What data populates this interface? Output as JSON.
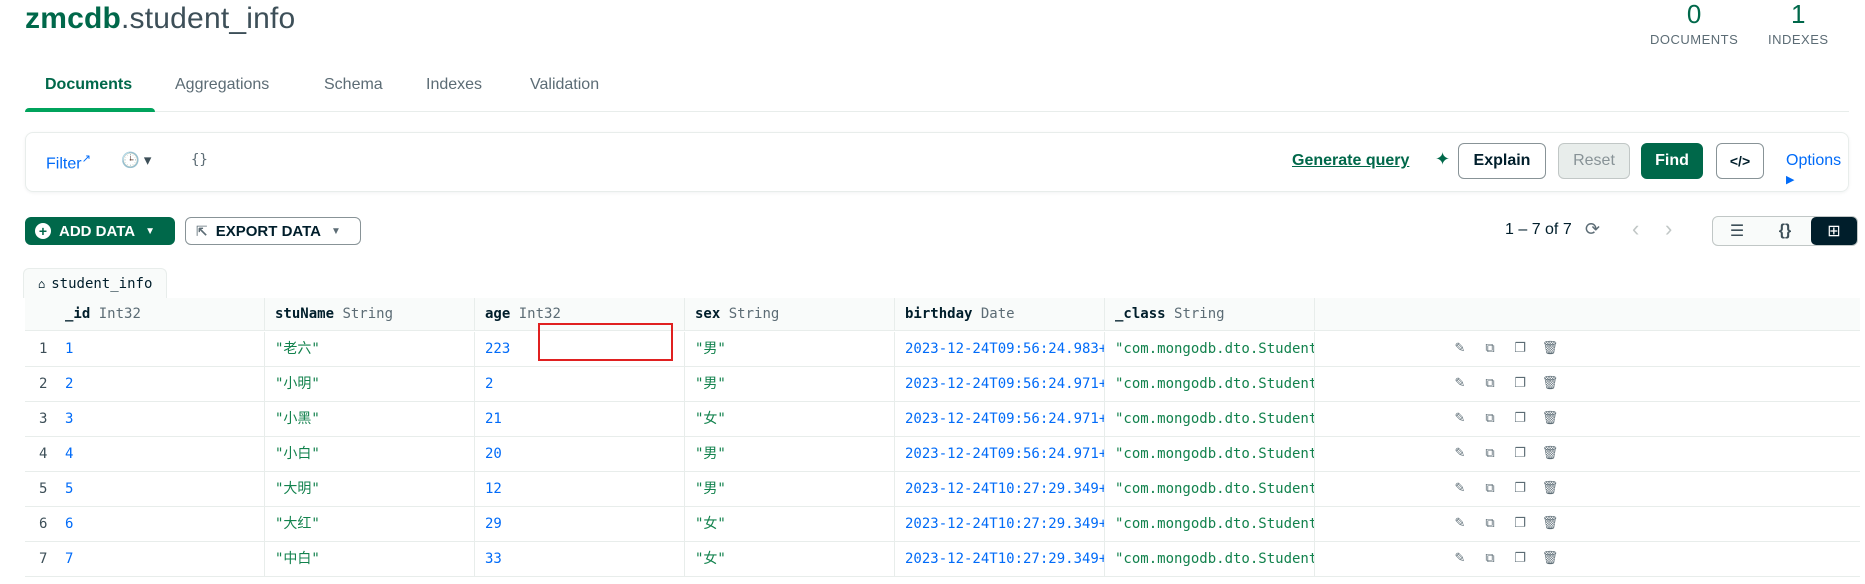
{
  "header": {
    "db": "zmcdb",
    "collection": ".student_info",
    "stats": [
      {
        "num": "0",
        "label": "DOCUMENTS"
      },
      {
        "num": "1",
        "label": "INDEXES"
      }
    ]
  },
  "tabs": [
    "Documents",
    "Aggregations",
    "Schema",
    "Indexes",
    "Validation"
  ],
  "querybar": {
    "filter_label": "Filter",
    "query": "{}",
    "generate_query": "Generate query",
    "explain": "Explain",
    "reset": "Reset",
    "find": "Find",
    "code": "</>",
    "options": "Options"
  },
  "toolbar": {
    "add_data": "ADD DATA",
    "export_data": "EXPORT DATA",
    "pager": "1 – 7 of 7"
  },
  "crumb": "student_info",
  "columns": [
    {
      "name": "_id",
      "type": "Int32"
    },
    {
      "name": "stuName",
      "type": "String"
    },
    {
      "name": "age",
      "type": "Int32"
    },
    {
      "name": "sex",
      "type": "String"
    },
    {
      "name": "birthday",
      "type": "Date"
    },
    {
      "name": "_class",
      "type": "String"
    }
  ],
  "rows": [
    {
      "n": "1",
      "id": "1",
      "name": "\"老六\"",
      "age": "223",
      "sex": "\"男\"",
      "birthday": "2023-12-24T09:56:24.983+0…",
      "cls": "\"com.mongodb.dto.StudentI…"
    },
    {
      "n": "2",
      "id": "2",
      "name": "\"小明\"",
      "age": "2",
      "sex": "\"男\"",
      "birthday": "2023-12-24T09:56:24.971+0…",
      "cls": "\"com.mongodb.dto.StudentI…"
    },
    {
      "n": "3",
      "id": "3",
      "name": "\"小黑\"",
      "age": "21",
      "sex": "\"女\"",
      "birthday": "2023-12-24T09:56:24.971+0…",
      "cls": "\"com.mongodb.dto.StudentI…"
    },
    {
      "n": "4",
      "id": "4",
      "name": "\"小白\"",
      "age": "20",
      "sex": "\"男\"",
      "birthday": "2023-12-24T09:56:24.971+0…",
      "cls": "\"com.mongodb.dto.StudentI…"
    },
    {
      "n": "5",
      "id": "5",
      "name": "\"大明\"",
      "age": "12",
      "sex": "\"男\"",
      "birthday": "2023-12-24T10:27:29.349+0…",
      "cls": "\"com.mongodb.dto.StudentI…"
    },
    {
      "n": "6",
      "id": "6",
      "name": "\"大红\"",
      "age": "29",
      "sex": "\"女\"",
      "birthday": "2023-12-24T10:27:29.349+0…",
      "cls": "\"com.mongodb.dto.StudentI…"
    },
    {
      "n": "7",
      "id": "7",
      "name": "\"中白\"",
      "age": "33",
      "sex": "\"女\"",
      "birthday": "2023-12-24T10:27:29.349+0…",
      "cls": "\"com.mongodb.dto.StudentI…"
    }
  ]
}
